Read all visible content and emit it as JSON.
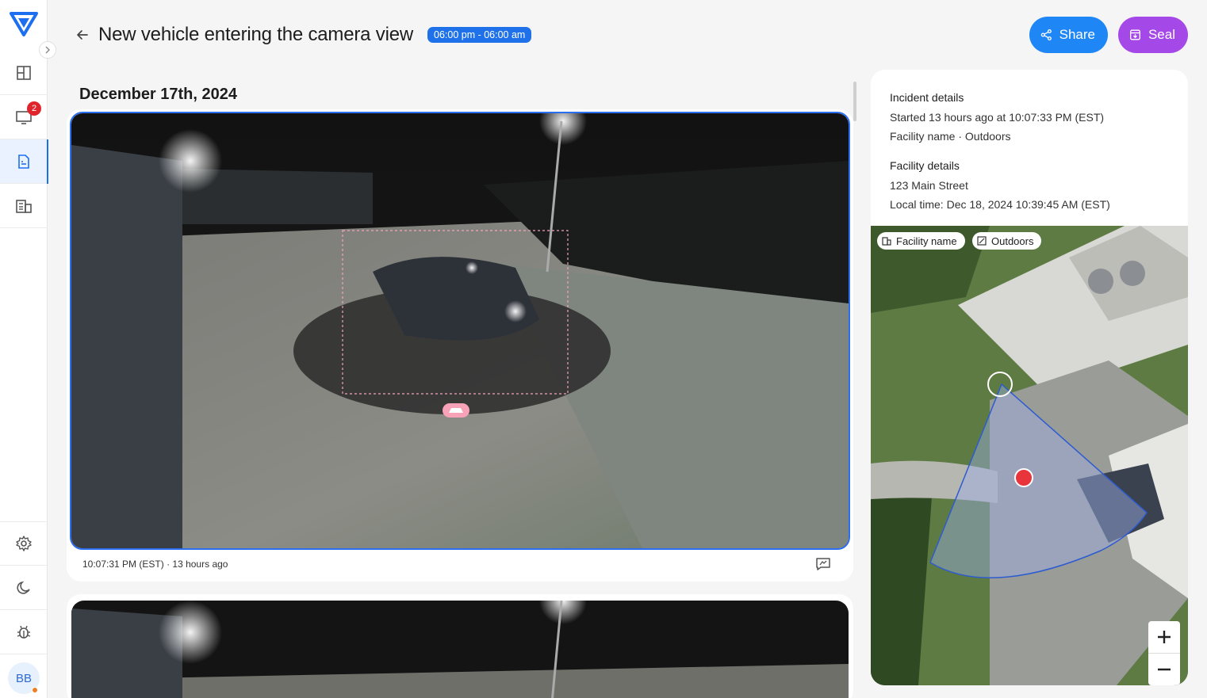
{
  "header": {
    "title": "New vehicle entering the camera view",
    "time_range": "06:00 pm - 06:00 am",
    "share_label": "Share",
    "seal_label": "Seal"
  },
  "sidebar": {
    "notification_count": "2",
    "user_initials": "BB"
  },
  "feed": {
    "date": "December 17th, 2024",
    "events": [
      {
        "timestamp": "10:07:31 PM (EST)",
        "relative": "13 hours ago"
      }
    ]
  },
  "incident": {
    "title": "Incident details",
    "started": "Started 13 hours ago at 10:07:33 PM (EST)",
    "facility": "Facility name · Outdoors"
  },
  "facility": {
    "title": "Facility details",
    "address": "123 Main Street",
    "local_time": "Local time: Dec 18, 2024 10:39:45 AM (EST)"
  },
  "map": {
    "facility_chip": "Facility name",
    "zone_chip": "Outdoors"
  },
  "colors": {
    "accent": "#1f71ea",
    "share": "#1f86f5",
    "seal": "#a548e8",
    "badge": "#e0242b"
  }
}
